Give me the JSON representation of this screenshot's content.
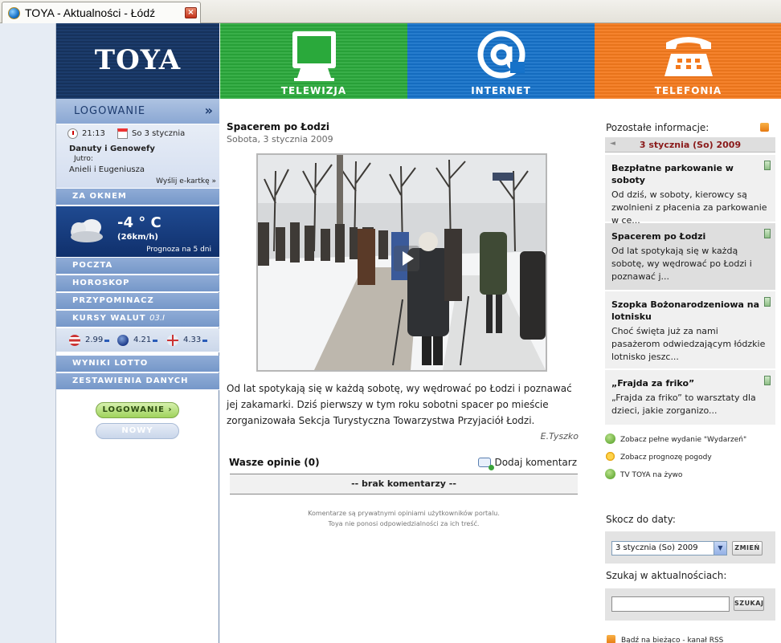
{
  "browser": {
    "tab_title": "TOYA - Aktualności - Łódź",
    "close_glyph": "×"
  },
  "header": {
    "logo": "TOYA",
    "nav": [
      {
        "label": "TELEWIZJA",
        "icon": "tv-icon",
        "color": "#2aa93b"
      },
      {
        "label": "INTERNET",
        "icon": "at-sign-icon",
        "color": "#1672c9"
      },
      {
        "label": "TELEFONIA",
        "icon": "telephone-icon",
        "color": "#f47a1d"
      }
    ]
  },
  "sidebar": {
    "login_title": "LOGOWANIE",
    "login_chevron": "»",
    "time": "21:13",
    "date": "So 3 stycznia",
    "names_today": "Danuty i Genowefy",
    "tomorrow_label": "Jutro:",
    "names_tomorrow": "Anieli i Eugeniusza",
    "ecard_link": "Wyślij e-kartkę »",
    "weather_title": "ZA OKNEM",
    "temperature": "-4 ° C",
    "wind": "(26km/h)",
    "forecast_link": "Prognoza na 5 dni",
    "menu": {
      "mail": "POCZTA",
      "horoscope": "HOROSKOP",
      "reminder": "PRZYPOMINACZ",
      "currency_title": "KURSY WALUT",
      "currency_date": "03.I",
      "lotto": "WYNIKI LOTTO",
      "data_summary": "ZESTAWIENIA DANYCH"
    },
    "currency": [
      {
        "flag": "usa-flag-icon",
        "value": "2.99"
      },
      {
        "flag": "eu-flag-icon",
        "value": "4.21"
      },
      {
        "flag": "uk-flag-icon",
        "value": "4.33"
      }
    ],
    "login_button": "LOGOWANIE",
    "new_subscriber_button": "NOWY ABONENT"
  },
  "article": {
    "title": "Spacerem po Łodzi",
    "date": "Sobota, 3 stycznia 2009",
    "body": "Od lat spotykają się w każdą sobotę, wy wędrować po Łodzi i poznawać jej zakamarki. Dziś pierwszy w tym roku sobotni spacer po mieście zorganizowała Sekcja Turystyczna Towarzystwa Przyjaciół Łodzi.",
    "author": "E.Tyszko",
    "opinions_label": "Wasze opinie (0)",
    "add_comment": "Dodaj komentarz",
    "no_comments": "-- brak komentarzy --",
    "disclaimer_line1": "Komentarze są prywatnymi opiniami użytkowników portalu.",
    "disclaimer_line2": "Toya nie ponosi odpowiedzialności za ich treść."
  },
  "rightcol": {
    "other_info_label": "Pozostałe informacje:",
    "date_nav": "3 stycznia (So) 2009",
    "date_nav_arrow": "◄",
    "news": [
      {
        "title": "Bezpłatne parkowanie w soboty",
        "text": "Od dziś, w soboty, kierowcy są zwolnieni z płacenia za parkowanie w ce..."
      },
      {
        "title": "Spacerem po Łodzi",
        "text": "Od lat spotykają się w każdą sobotę, wy wędrować po Łodzi i poznawać j..."
      },
      {
        "title": "Szopka Bożonarodzeniowa na lotnisku",
        "text": "Choć święta już za nami pasażerom odwiedzającym łódzkie lotnisko jeszc..."
      },
      {
        "title": "„Frajda za friko”",
        "text": "„Frajda za friko” to warsztaty dla dzieci, jakie zorganizo..."
      }
    ],
    "links": {
      "full_edition": "Zobacz pełne wydanie \"Wydarzeń\"",
      "weather_forecast": "Zobacz prognozę pogody",
      "tv_live": "TV TOYA na żywo"
    },
    "jump_label": "Skocz do daty:",
    "date_select_value": "3 stycznia (So) 2009",
    "change_button": "ZMIEŃ",
    "search_label": "Szukaj w aktualnościach:",
    "search_value": "",
    "search_button": "SZUKAJ",
    "rss_link": "Bądź na bieżąco - kanał RSS"
  }
}
